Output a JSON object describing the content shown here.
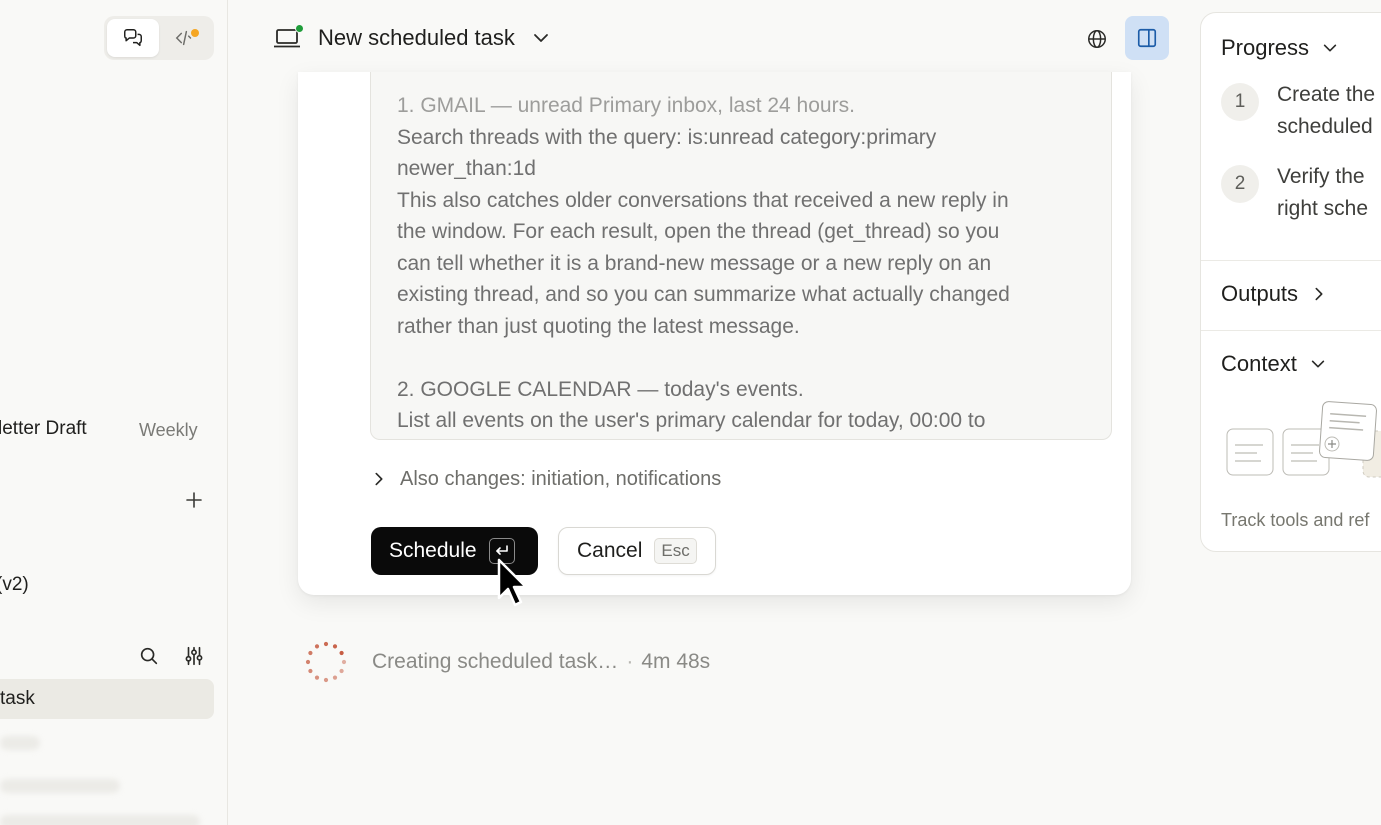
{
  "sidebar": {
    "items": [
      {
        "label": "letter Draft",
        "meta": "Weekly"
      },
      {
        "label": "(v2)"
      },
      {
        "label": "task"
      }
    ]
  },
  "header": {
    "title": "New scheduled task"
  },
  "card": {
    "prompt_lines": [
      "1. GMAIL — unread Primary inbox, last 24 hours.",
      "Search threads with the query: is:unread category:primary",
      "newer_than:1d",
      "This also catches older conversations that received a new reply in",
      "the window. For each result, open the thread (get_thread) so you",
      "can tell whether it is a brand-new message or a new reply on an",
      "existing thread, and so you can summarize what actually changed",
      "rather than just quoting the latest message.",
      "",
      "2. GOOGLE CALENDAR — today's events.",
      "List all events on the user's primary calendar for today, 00:00 to"
    ],
    "also_changes": "Also changes: initiation, notifications",
    "schedule_label": "Schedule",
    "cancel_label": "Cancel",
    "esc_label": "Esc"
  },
  "status": {
    "text": "Creating scheduled task…",
    "separator": "·",
    "elapsed": "4m 48s"
  },
  "right_panel": {
    "progress_title": "Progress",
    "steps": [
      {
        "num": "1",
        "line1": "Create the",
        "line2": "scheduled"
      },
      {
        "num": "2",
        "line1": "Verify the",
        "line2": "right sche"
      }
    ],
    "outputs_title": "Outputs",
    "context_title": "Context",
    "track_text": "Track tools and ref"
  },
  "colors": {
    "primary_button": "#0a0a0a",
    "panel_toggle_active": "#cfe0f5",
    "spinner": "#c4553a",
    "online_dot": "#1f9d3a",
    "code_dot": "#f5a623"
  }
}
